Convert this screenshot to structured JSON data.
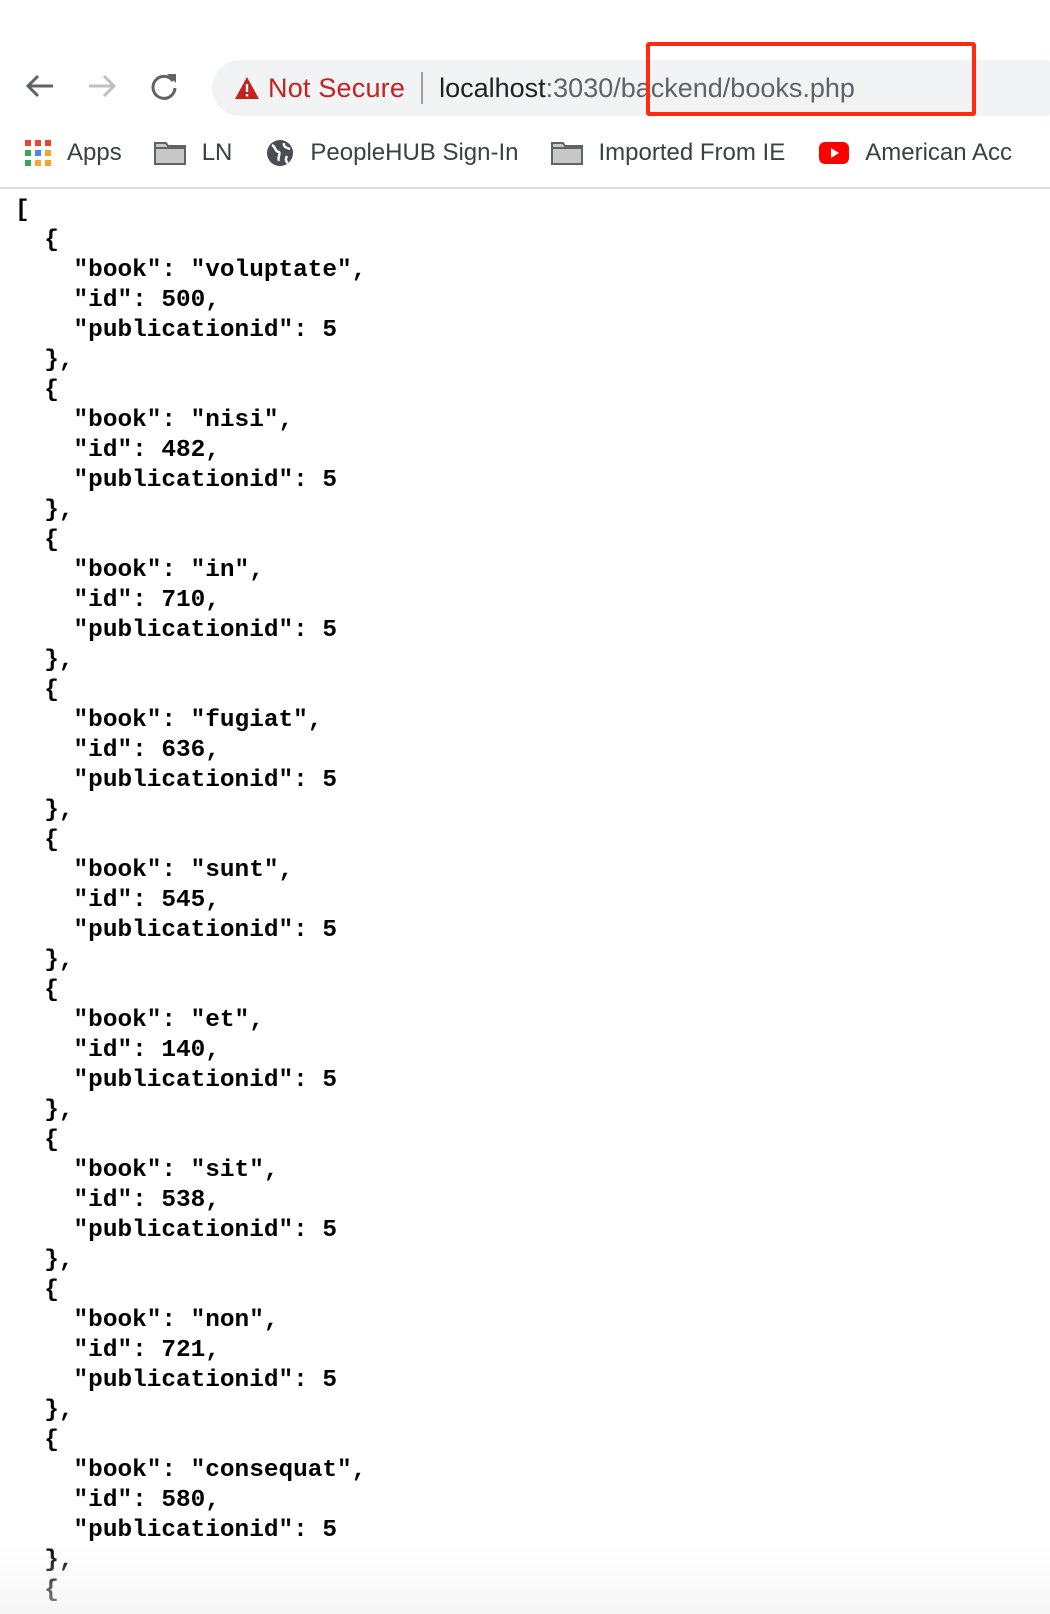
{
  "browser": {
    "nav": {
      "back_icon": "arrow-left-icon",
      "forward_icon": "arrow-right-icon",
      "reload_icon": "reload-icon"
    },
    "omnibox": {
      "security_icon": "warning-triangle-icon",
      "security_label": "Not Secure",
      "url_host": "localhost",
      "url_rest": ":3030/backend/books.php"
    },
    "bookmarks": [
      {
        "label": "Apps",
        "icon": "apps-grid-icon"
      },
      {
        "label": "LN",
        "icon": "folder-icon"
      },
      {
        "label": "PeopleHUB Sign-In",
        "icon": "globe-icon"
      },
      {
        "label": "Imported From IE",
        "icon": "folder-icon"
      },
      {
        "label": "American Acc",
        "icon": "youtube-icon"
      }
    ],
    "annotation": {
      "color": "#ff2a10",
      "target": "/backend/books.php"
    },
    "colors": {
      "not_secure": "#c5221f",
      "omnibox_bg": "#f1f3f4"
    }
  },
  "page": {
    "books": [
      {
        "book": "voluptate",
        "id": 500,
        "publicationid": 5
      },
      {
        "book": "nisi",
        "id": 482,
        "publicationid": 5
      },
      {
        "book": "in",
        "id": 710,
        "publicationid": 5
      },
      {
        "book": "fugiat",
        "id": 636,
        "publicationid": 5
      },
      {
        "book": "sunt",
        "id": 545,
        "publicationid": 5
      },
      {
        "book": "et",
        "id": 140,
        "publicationid": 5
      },
      {
        "book": "sit",
        "id": 538,
        "publicationid": 5
      },
      {
        "book": "non",
        "id": 721,
        "publicationid": 5
      },
      {
        "book": "consequat",
        "id": 580,
        "publicationid": 5
      }
    ],
    "trailing_text": "  {"
  }
}
